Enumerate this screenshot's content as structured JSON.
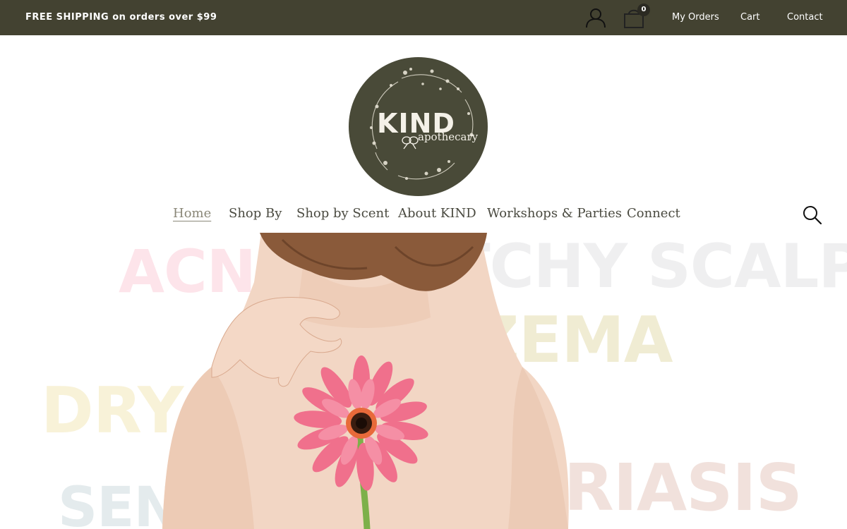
{
  "topbar": {
    "promo": "FREE SHIPPING on orders over $99",
    "cart_count": "0",
    "links": {
      "my_orders": "My Orders",
      "cart": "Cart",
      "contact": "Contact"
    },
    "background": "#434231"
  },
  "logo": {
    "name": "KIND",
    "subtitle": "apothecary",
    "color": "#494a38"
  },
  "nav": {
    "items": [
      {
        "label": "Home",
        "active": true
      },
      {
        "label": "Shop By"
      },
      {
        "label": "Shop by Scent"
      },
      {
        "label": "About KIND"
      },
      {
        "label": "Workshops & Parties"
      },
      {
        "label": "Connect"
      }
    ],
    "search_icon": "search-icon"
  },
  "hero": {
    "words": {
      "acne": "ACNE",
      "itchy_scalp": "ITCHY SCALP",
      "eczema": "ECZEMA",
      "dry": "DRY",
      "psoriasis": "PSORIASIS",
      "sensitive": "SENSITIVE"
    }
  }
}
